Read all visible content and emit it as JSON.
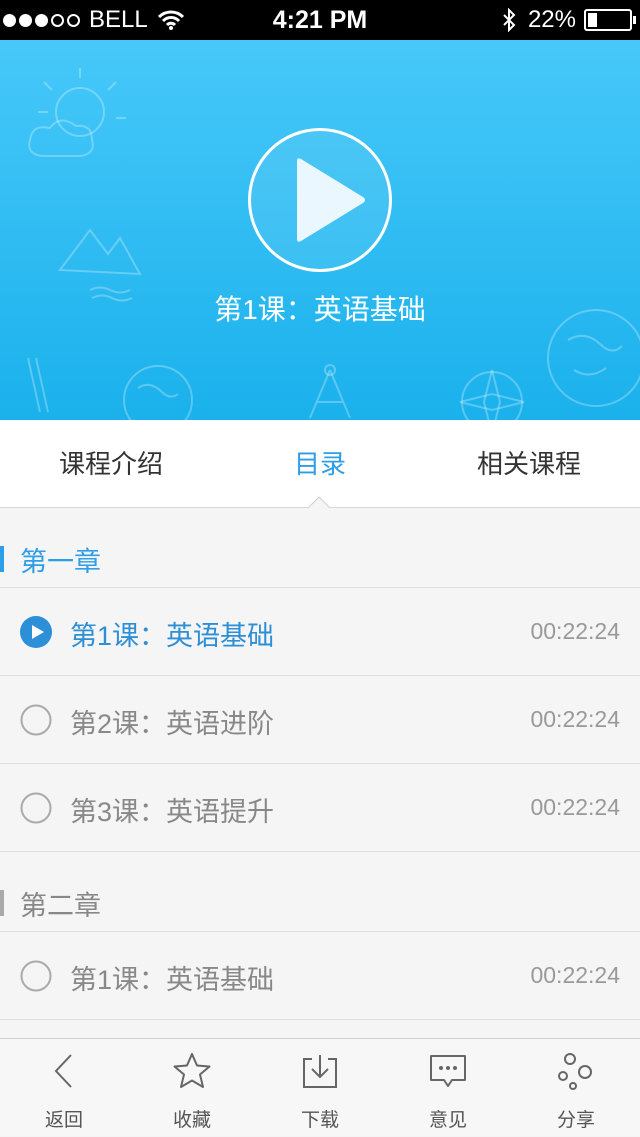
{
  "status_bar": {
    "carrier": "BELL",
    "time": "4:21 PM",
    "battery": "22%",
    "battery_level": 0.22
  },
  "hero": {
    "title": "第1课：英语基础"
  },
  "tabs": [
    {
      "label": "课程介绍"
    },
    {
      "label": "目录"
    },
    {
      "label": "相关课程"
    }
  ],
  "chapters": [
    {
      "label": "第一章",
      "color": "#2d9ee8",
      "lessons": [
        {
          "title": "第1课：英语基础",
          "time": "00:22:24",
          "active": true
        },
        {
          "title": "第2课：英语进阶",
          "time": "00:22:24",
          "active": false
        },
        {
          "title": "第3课：英语提升",
          "time": "00:22:24",
          "active": false
        }
      ]
    },
    {
      "label": "第二章",
      "color": "#aaaaaa",
      "lessons": [
        {
          "title": "第1课：英语基础",
          "time": "00:22:24",
          "active": false
        }
      ]
    }
  ],
  "bottom_nav": [
    {
      "label": "返回",
      "icon": "back-icon"
    },
    {
      "label": "收藏",
      "icon": "star-icon"
    },
    {
      "label": "下载",
      "icon": "download-icon"
    },
    {
      "label": "意见",
      "icon": "feedback-icon"
    },
    {
      "label": "分享",
      "icon": "share-icon"
    }
  ],
  "colors": {
    "accent": "#2d9ee8",
    "hero": "#2bbcf4"
  }
}
